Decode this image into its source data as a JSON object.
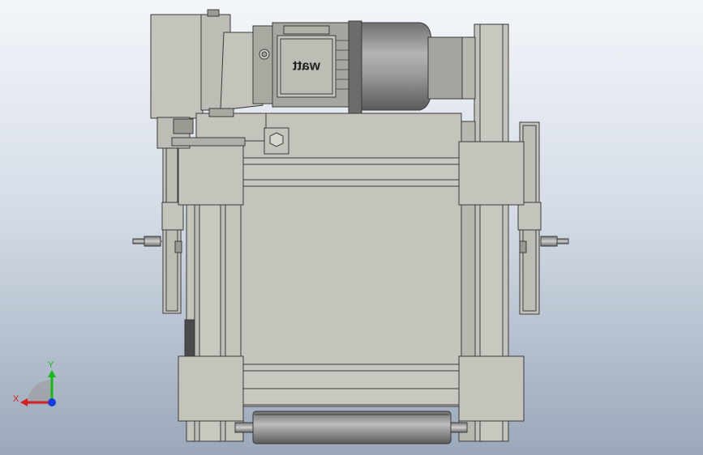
{
  "viewport": {
    "background_top": "#f3f6fa",
    "background_bottom": "#9aa8ba"
  },
  "model": {
    "body_color": "#c4c4bc",
    "edge_color": "#3a3a3a",
    "motor_color": "#8e8e8e",
    "motor_brand": "watt"
  },
  "triad": {
    "x_label": "X",
    "y_label": "Y",
    "x_color": "#d42020",
    "y_color": "#19b819",
    "z_color": "#1a3ad8"
  }
}
